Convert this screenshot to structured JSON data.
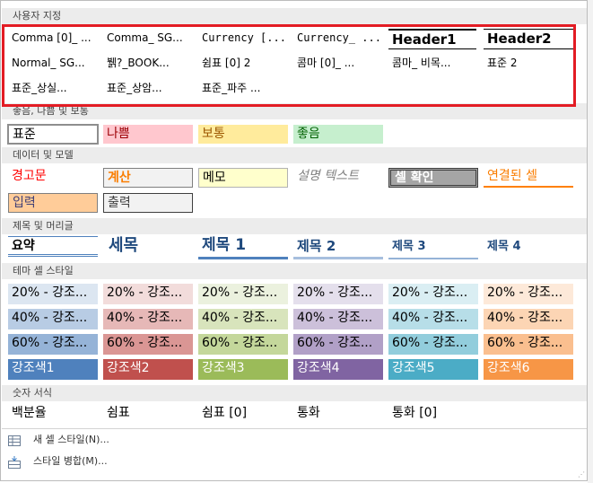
{
  "sections": {
    "custom": "사용자 지정",
    "good_bad": "좋음, 나쁨 및 보통",
    "data_model": "데이터 및 모델",
    "titles": "제목 및 머리글",
    "theme": "테마 셀 스타일",
    "number": "숫자 서식"
  },
  "custom_styles": [
    [
      "Comma [0]_ ...",
      "Comma_ SG...",
      "Currency [...",
      "Currency_ ...",
      "Header1",
      "Header2"
    ],
    [
      "Normal_ SG...",
      "뷁?_BOOK...",
      "쉼표 [0] 2",
      "콤마 [0]_ ...",
      "콤마_ 비목...",
      "표준 2"
    ],
    [
      "표준_상실...",
      "표준_상암...",
      "표준_파주 ..."
    ]
  ],
  "good_bad": [
    "표준",
    "나쁨",
    "보통",
    "좋음"
  ],
  "data_model": {
    "row1": [
      "경고문",
      "계산",
      "메모",
      "설명 텍스트",
      "셀 확인",
      "연결된 셀"
    ],
    "row2": [
      "입력",
      "출력"
    ]
  },
  "titles": [
    "요약",
    "세목",
    "제목 1",
    "제목 2",
    "제목 3",
    "제목 4"
  ],
  "theme": {
    "row20": [
      "20% - 강조...",
      "20% - 강조...",
      "20% - 강조...",
      "20% - 강조...",
      "20% - 강조...",
      "20% - 강조..."
    ],
    "row40": [
      "40% - 강조...",
      "40% - 강조...",
      "40% - 강조...",
      "40% - 강조...",
      "40% - 강조...",
      "40% - 강조..."
    ],
    "row60": [
      "60% - 강조...",
      "60% - 강조...",
      "60% - 강조...",
      "60% - 강조...",
      "60% - 강조...",
      "60% - 강조..."
    ],
    "accents": [
      "강조색1",
      "강조색2",
      "강조색3",
      "강조색4",
      "강조색5",
      "강조색6"
    ]
  },
  "number_formats": [
    "백분율",
    "쉼표",
    "쉼표 [0]",
    "통화",
    "통화 [0]"
  ],
  "footer": {
    "new_style": "새 셀 스타일(N)...",
    "merge_styles": "스타일 병합(M)..."
  },
  "colors": {
    "highlight_box": "#e31c24",
    "accent1": "#4f81bd",
    "accent2": "#c0504d",
    "accent3": "#9bbb59",
    "accent4": "#8064a2",
    "accent5": "#4bacc6",
    "accent6": "#f79646"
  },
  "icons": {
    "new_style": "cell-style-icon",
    "merge_styles": "merge-styles-icon"
  }
}
